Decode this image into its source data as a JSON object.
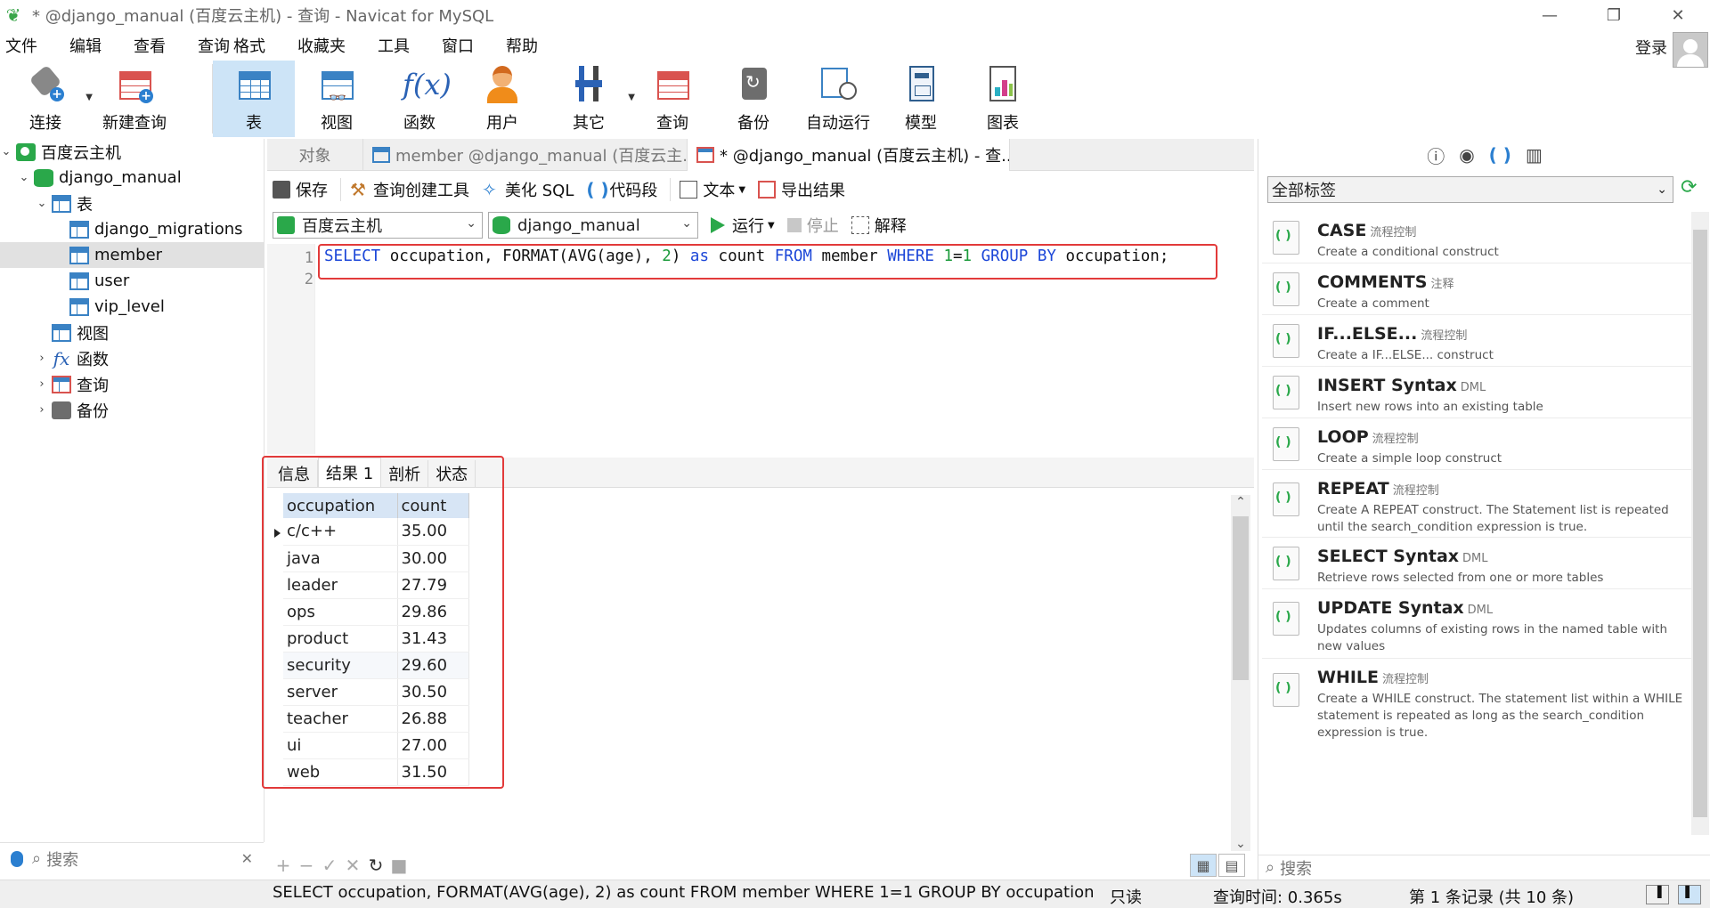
{
  "window": {
    "title": "*  @django_manual (百度云主机) - 查询 - Navicat for MySQL",
    "minimize": "—",
    "restore": "❐",
    "close": "✕"
  },
  "menu": {
    "items": [
      "文件",
      "编辑",
      "查看",
      "查询",
      "格式",
      "收藏夹",
      "工具",
      "窗口",
      "帮助"
    ],
    "login": "登录"
  },
  "toolbar": {
    "connect": "连接",
    "new_query": "新建查询",
    "table": "表",
    "view": "视图",
    "function": "函数",
    "user": "用户",
    "other": "其它",
    "query": "查询",
    "backup": "备份",
    "auto_run": "自动运行",
    "model": "模型",
    "chart": "图表"
  },
  "navigator": {
    "items": [
      {
        "label": "百度云主机"
      },
      {
        "label": "django_manual"
      },
      {
        "label": "表"
      },
      {
        "label": "django_migrations"
      },
      {
        "label": "member"
      },
      {
        "label": "user"
      },
      {
        "label": "vip_level"
      },
      {
        "label": "视图"
      },
      {
        "label": "函数"
      },
      {
        "label": "查询"
      },
      {
        "label": "备份"
      }
    ],
    "search_placeholder": "搜索",
    "clear": "✕"
  },
  "tabs": {
    "objects": "对象",
    "member": "member @django_manual (百度云主...",
    "query": "*  @django_manual (百度云主机) - 查..."
  },
  "query_toolbar": {
    "save": "保存",
    "builder": "查询创建工具",
    "beautify": "美化 SQL",
    "snippet": "代码段",
    "text": "文本",
    "export": "导出结果"
  },
  "selectors": {
    "connection": "百度云主机",
    "database": "django_manual",
    "run": "运行",
    "stop": "停止",
    "explain": "解释"
  },
  "editor": {
    "line_numbers": [
      "1",
      "2"
    ],
    "sql": {
      "t1": "SELECT",
      "t2": " occupation, FORMAT(AVG(age), ",
      "t3": "2",
      "t4": ") ",
      "t5": "as",
      "t6": " count ",
      "t7": "FROM",
      "t8": " member ",
      "t9": "WHERE",
      "t10": " ",
      "t11": "1",
      "t12": "=",
      "t13": "1",
      "t14": " ",
      "t15": "GROUP BY",
      "t16": " occupation;"
    }
  },
  "result_tabs": [
    "信息",
    "结果 1",
    "剖析",
    "状态"
  ],
  "result": {
    "columns": [
      "occupation",
      "count"
    ],
    "rows": [
      [
        "c/c++",
        "35.00"
      ],
      [
        "java",
        "30.00"
      ],
      [
        "leader",
        "27.79"
      ],
      [
        "ops",
        "29.86"
      ],
      [
        "product",
        "31.43"
      ],
      [
        "security",
        "29.60"
      ],
      [
        "server",
        "30.50"
      ],
      [
        "teacher",
        "26.88"
      ],
      [
        "ui",
        "27.00"
      ],
      [
        "web",
        "31.50"
      ]
    ]
  },
  "status": {
    "sql": "SELECT occupation, FORMAT(AVG(age), 2) as count FROM member WHERE 1=1 GROUP BY occupation",
    "readonly": "只读",
    "query_time": "查询时间: 0.365s",
    "records": "第 1 条记录  (共 10 条)"
  },
  "snippets": {
    "filter": "全部标签",
    "search_placeholder": "搜索",
    "items": [
      {
        "title": "CASE",
        "tag": "流程控制",
        "desc": "Create a conditional construct"
      },
      {
        "title": "COMMENTS",
        "tag": "注释",
        "desc": "Create a comment"
      },
      {
        "title": "IF...ELSE...",
        "tag": "流程控制",
        "desc": "Create a IF...ELSE... construct"
      },
      {
        "title": "INSERT Syntax",
        "tag": "DML",
        "desc": "Insert new rows into an existing table"
      },
      {
        "title": "LOOP",
        "tag": "流程控制",
        "desc": "Create a simple loop construct"
      },
      {
        "title": "REPEAT",
        "tag": "流程控制",
        "desc": "Create A REPEAT construct. The Statement list is repeated until the search_condition expression is true."
      },
      {
        "title": "SELECT Syntax",
        "tag": "DML",
        "desc": "Retrieve rows selected from one or more tables"
      },
      {
        "title": "UPDATE Syntax",
        "tag": "DML",
        "desc": "Updates columns of existing rows in the named table with new values"
      },
      {
        "title": "WHILE",
        "tag": "流程控制",
        "desc": "Create a WHILE construct. The statement list within a WHILE statement is repeated as long as the search_condition expression is true."
      }
    ]
  },
  "colors": {
    "accent": "#3a82c4",
    "highlight_border": "#e23a3a",
    "sql_keyword": "#1b46d8",
    "sql_number": "#1a9a3a",
    "connection_green": "#2aa84a"
  }
}
